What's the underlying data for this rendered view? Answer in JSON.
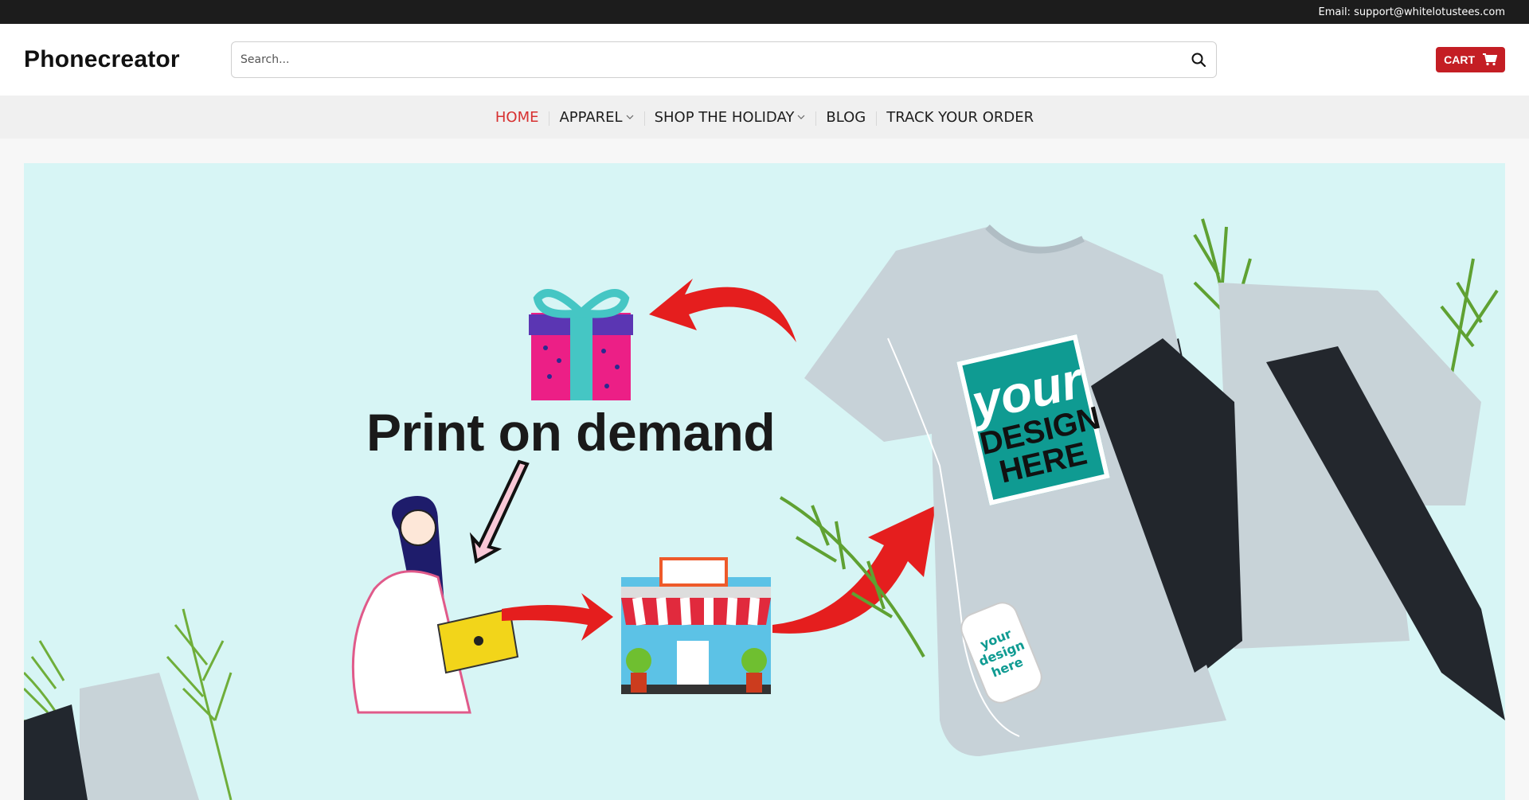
{
  "topbar": {
    "email_text": "Email: support@whitelotustees.com"
  },
  "header": {
    "logo": "Phonecreator",
    "search": {
      "placeholder": "Search...",
      "value": "",
      "icon": "search-icon"
    },
    "cart": {
      "label": "CART",
      "icon": "cart-icon",
      "color": "#c41e24"
    }
  },
  "nav": {
    "items": [
      {
        "label": "HOME",
        "active": true,
        "dropdown": false
      },
      {
        "label": "APPAREL",
        "active": false,
        "dropdown": true
      },
      {
        "label": "SHOP THE HOLIDAY",
        "active": false,
        "dropdown": true
      },
      {
        "label": "BLOG",
        "active": false,
        "dropdown": false
      },
      {
        "label": "TRACK YOUR ORDER",
        "active": false,
        "dropdown": false
      }
    ],
    "active_color": "#d73131"
  },
  "hero": {
    "title": "Print on demand",
    "shirt_print": {
      "line1": "your",
      "line2": "DESIGN",
      "line3": "HERE"
    },
    "phone_case_text": "your design here",
    "background_color": "#d7f5f5"
  }
}
